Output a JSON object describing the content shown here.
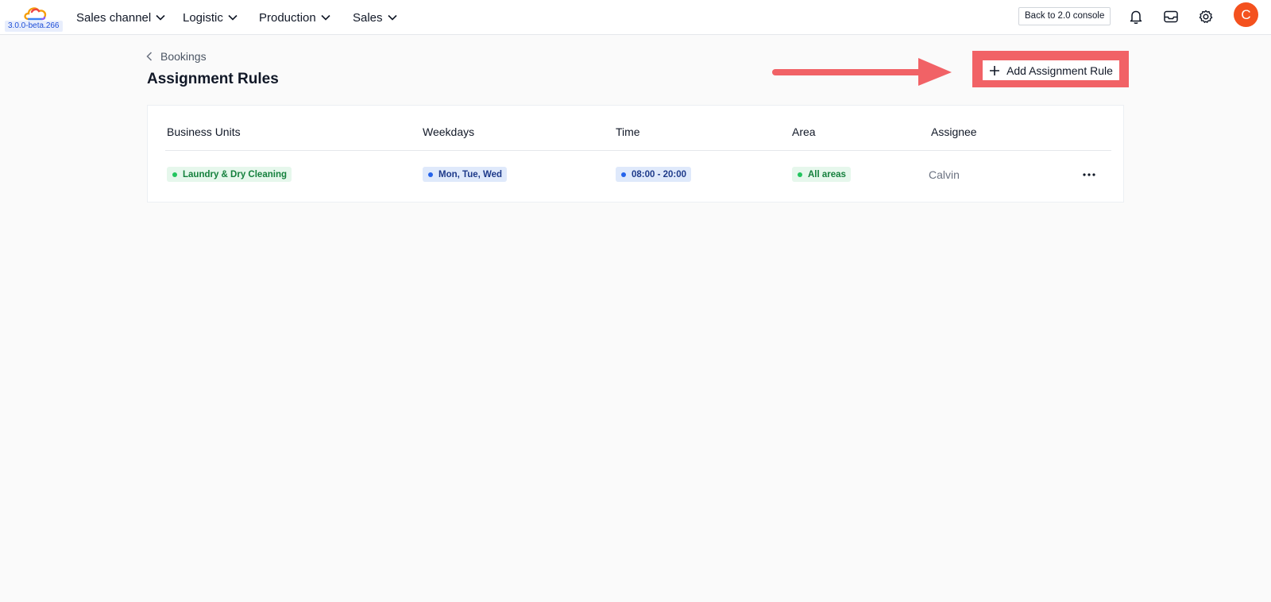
{
  "app": {
    "version": "3.0.0-beta.266",
    "nav": [
      {
        "label": "Sales channel"
      },
      {
        "label": "Logistic"
      },
      {
        "label": "Production"
      },
      {
        "label": "Sales"
      }
    ],
    "back_console_label": "Back to 2.0 console",
    "user_initial": "C"
  },
  "page": {
    "breadcrumb": "Bookings",
    "title": "Assignment Rules",
    "add_button_label": "Add Assignment Rule"
  },
  "table": {
    "columns": [
      "Business Units",
      "Weekdays",
      "Time",
      "Area",
      "Assignee"
    ],
    "rows": [
      {
        "business_unit": "Laundry & Dry Cleaning",
        "weekdays": "Mon, Tue, Wed",
        "time": "08:00 - 20:00",
        "area": "All areas",
        "assignee": "Calvin"
      }
    ]
  },
  "colors": {
    "accent_highlight": "#f16266",
    "avatar": "#f4511e",
    "tag_green": "#15803d",
    "tag_blue": "#1e3a8a"
  }
}
